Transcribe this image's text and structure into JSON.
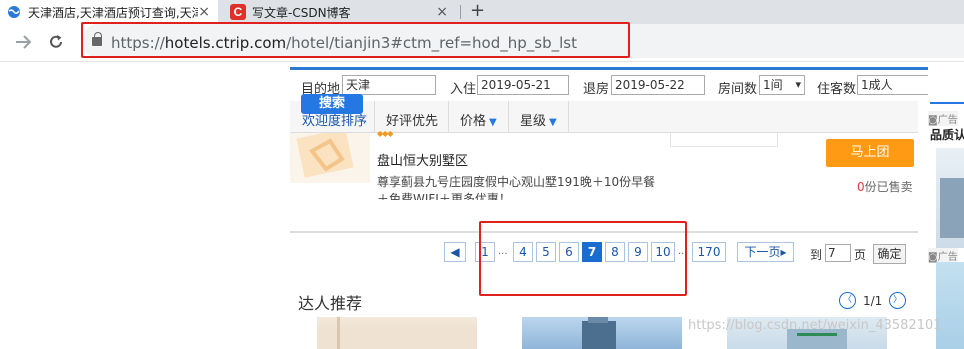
{
  "browser": {
    "tabs": [
      {
        "title": "天津酒店,天津酒店预订查询,天津",
        "active": true
      },
      {
        "title": "写文章-CSDN博客",
        "active": false
      }
    ],
    "new_tab": "+",
    "close": "×",
    "url_prefix": "https://",
    "url_host": "hotels.ctrip.com",
    "url_path": "/hotel/tianjin3#ctm_ref=hod_hp_sb_lst",
    "csdn_favicon_letter": "C"
  },
  "search": {
    "dest_label": "目的地",
    "dest_value": "天津",
    "checkin_label": "入住",
    "checkin_value": "2019-05-21",
    "checkout_label": "退房",
    "checkout_value": "2019-05-22",
    "rooms_label": "房间数",
    "rooms_value": "1间",
    "guests_label": "住客数",
    "guests_value": "1成人",
    "search_button": "搜索"
  },
  "sort": {
    "items": [
      "欢迎度排序",
      "好评优先",
      "价格",
      "星级"
    ]
  },
  "hotel": {
    "stars": "◆◆◆",
    "name": "盘山恒大别墅区",
    "desc_line1": "尊享蓟县九号庄园度假中心观山墅191晚＋10份早餐",
    "desc_line2": "＋免费WIFI＋更多优惠！",
    "buy_button": "马上团",
    "sold_count": "0",
    "sold_suffix": "份已售卖"
  },
  "pagination": {
    "prev": "◀",
    "pages": [
      "1",
      "4",
      "5",
      "6",
      "7",
      "8",
      "9",
      "10",
      "170"
    ],
    "current": "7",
    "dots": "...",
    "next": "下一页▸",
    "goto_label": "到",
    "goto_value": "7",
    "page_unit": "页",
    "confirm": "确定"
  },
  "experts": {
    "title": "达人推荐",
    "counter": "1/1",
    "prev": "〈",
    "next": "〉"
  },
  "right_ads": {
    "ad_label": "广告",
    "brand_text": "品质认"
  },
  "watermark": "https://blog.csdn.net/weixin_43582101",
  "colors": {
    "accent": "#2577e3",
    "highlight_box": "#e0201c",
    "buy_orange": "#ff9a14"
  }
}
